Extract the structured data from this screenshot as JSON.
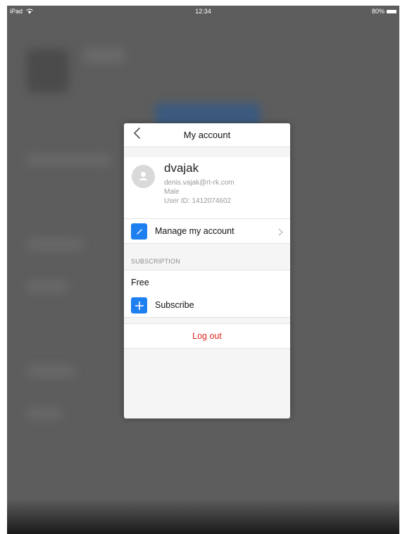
{
  "status_bar": {
    "device": "iPad",
    "time": "12:34",
    "battery": "80%"
  },
  "modal": {
    "title": "My account",
    "profile": {
      "username": "dvajak",
      "email": "denis.vajak@rt-rk.com",
      "gender": "Male",
      "user_id": "User ID: 1412074602"
    },
    "manage_label": "Manage my account",
    "subscription_header": "SUBSCRIPTION",
    "plan": "Free",
    "subscribe_label": "Subscribe",
    "logout_label": "Log out"
  },
  "colors": {
    "accent": "#1e7ff0",
    "destructive": "#e0281f",
    "dim_background": "#5d5d5d"
  },
  "icons": [
    "wifi-icon",
    "battery-icon",
    "back-chevron-icon",
    "avatar-placeholder-icon",
    "pencil-icon",
    "chevron-right-icon",
    "plus-icon"
  ]
}
